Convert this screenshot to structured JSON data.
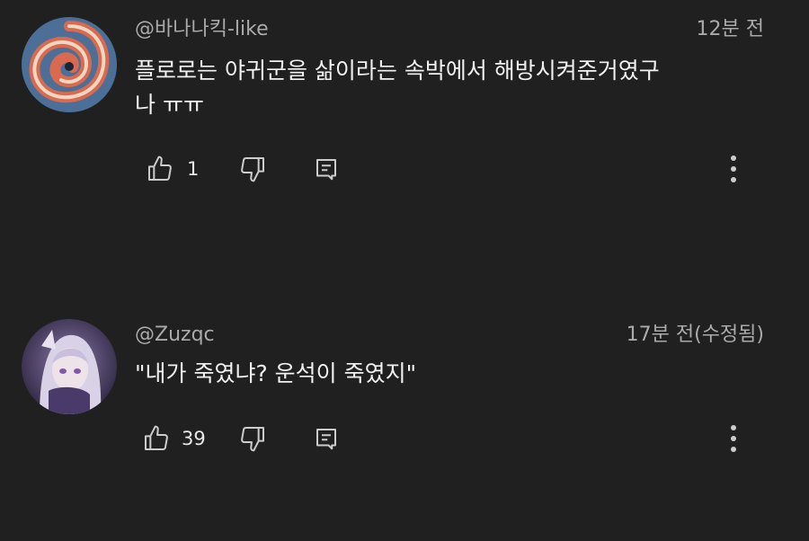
{
  "comments": [
    {
      "author": "@바나나킥-like",
      "time": "12분 전",
      "text": "플로로는 야귀군을 삶이라는 속박에서 해방시켜준거였구\n나 ㅠㅠ",
      "likes": "1",
      "avatar": "swirl-avatar",
      "icons": [
        "thumbs-up-icon",
        "thumbs-down-icon",
        "reply-icon",
        "more-vert-icon"
      ]
    },
    {
      "author": "@Zuzqc",
      "time": "17분 전(수정됨)",
      "text": "\"내가 죽였냐? 운석이 죽였지\"",
      "likes": "39",
      "avatar": "anime-girl-avatar",
      "icons": [
        "thumbs-up-icon",
        "thumbs-down-icon",
        "reply-icon",
        "more-vert-icon"
      ]
    }
  ],
  "colors": {
    "background": "#202020",
    "primary_text": "#f1f1f1",
    "secondary_text": "#aaaaaa",
    "icon": "#cccccc"
  }
}
